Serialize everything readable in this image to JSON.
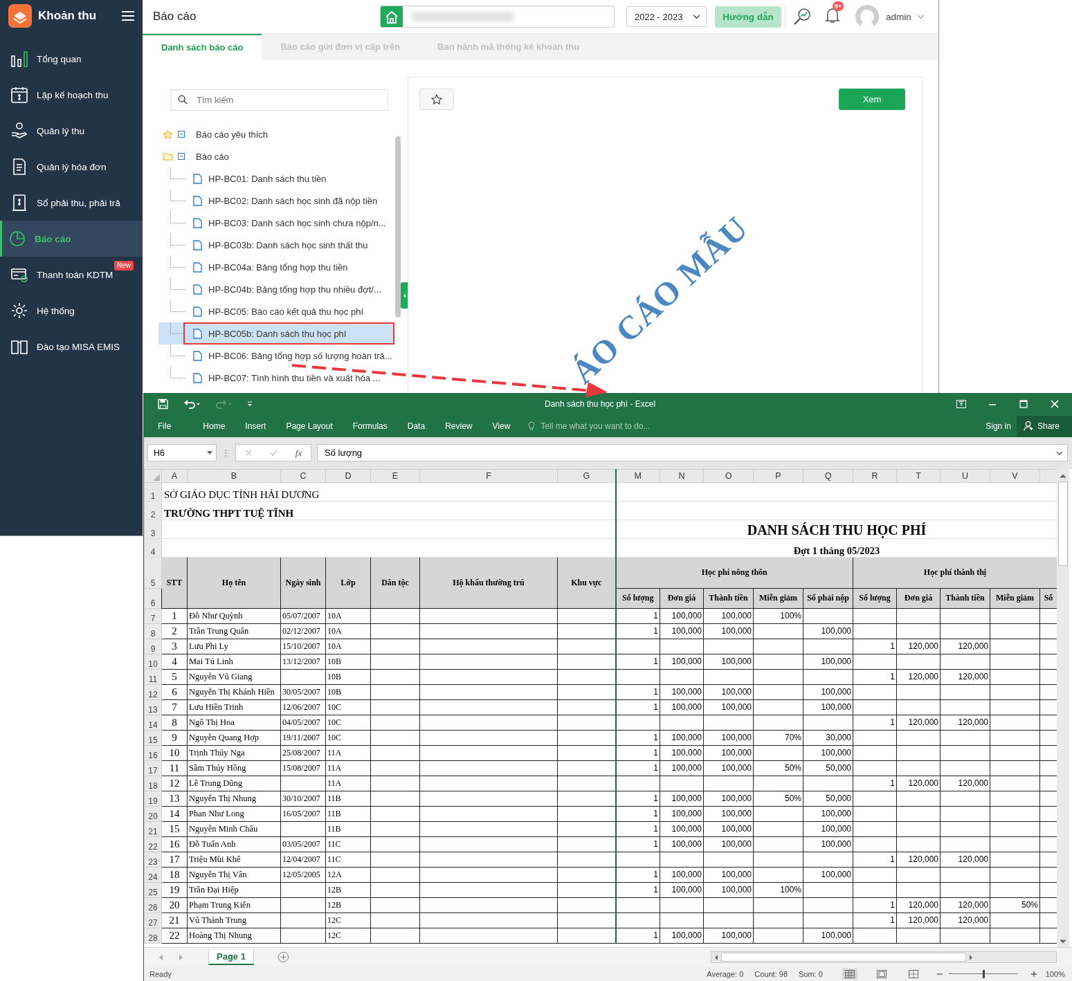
{
  "app": {
    "brand": "Khoản thu",
    "nav": [
      {
        "label": "Tổng quan",
        "selected": false
      },
      {
        "label": "Lập kế hoạch thu",
        "selected": false
      },
      {
        "label": "Quản lý thu",
        "selected": false
      },
      {
        "label": "Quản lý hóa đơn",
        "selected": false
      },
      {
        "label": "Sổ phải thu, phải trả",
        "selected": false
      },
      {
        "label": "Báo cáo",
        "selected": true
      },
      {
        "label": "Thanh toán KDTM",
        "selected": false,
        "badge": "New"
      },
      {
        "label": "Hệ thống",
        "selected": false
      },
      {
        "label": "Đào tạo MISA EMIS",
        "selected": false
      }
    ],
    "header": {
      "title": "Báo cáo",
      "year": "2022 - 2023",
      "guide_button": "Hướng dẫn",
      "notification_badge": "9+",
      "user": "admin"
    },
    "tabs": [
      {
        "label": "Danh sách báo cáo",
        "selected": true
      },
      {
        "label": "Báo cáo gửi đơn vị cấp trên",
        "selected": false
      },
      {
        "label": "Ban hành mã thống kê khoản thu",
        "selected": false
      }
    ],
    "search": {
      "placeholder": "Tìm kiếm"
    },
    "tree": [
      {
        "label": "Báo cáo yêu thích",
        "kind": "favorites",
        "expanded": true
      },
      {
        "label": "Báo cáo",
        "kind": "folder",
        "expanded": true,
        "children": [
          {
            "label": "HP-BC01: Danh sách thu tiền",
            "selected": false,
            "highlighted": false
          },
          {
            "label": "HP-BC02: Danh sách học sinh đã nộp tiền",
            "selected": false,
            "highlighted": false
          },
          {
            "label": "HP-BC03: Danh sách học sinh chưa nộp/n...",
            "selected": false,
            "highlighted": false
          },
          {
            "label": "HP-BC03b: Danh sách học sinh thất thu",
            "selected": false,
            "highlighted": false
          },
          {
            "label": "HP-BC04a: Bảng tổng hợp thu tiền",
            "selected": false,
            "highlighted": false
          },
          {
            "label": "HP-BC04b: Bảng tổng hợp thu nhiều đợt/...",
            "selected": false,
            "highlighted": false
          },
          {
            "label": "HP-BC05: Báo cáo kết quả thu học phí",
            "selected": false,
            "highlighted": false
          },
          {
            "label": "HP-BC05b: Danh sách thu học phí",
            "selected": true,
            "highlighted": true
          },
          {
            "label": "HP-BC06: Bảng tổng hợp số lượng hoàn trả...",
            "selected": false,
            "highlighted": false
          },
          {
            "label": "HP-BC07: Tình hình thu tiền và xuất hóa ...",
            "selected": false,
            "highlighted": false
          }
        ]
      }
    ],
    "preview": {
      "view_button": "Xem",
      "watermark": "ÁO CÁO MẪU"
    }
  },
  "excel": {
    "title": "Danh sách thu học phí - Excel",
    "menu": [
      "File",
      "Home",
      "Insert",
      "Page Layout",
      "Formulas",
      "Data",
      "Review",
      "View"
    ],
    "tell_me": {
      "placeholder": "Tell me what you want to do..."
    },
    "sign_in": "Sign in",
    "share": "Share",
    "name_box": "H6",
    "function_symbol": "fx",
    "formula": "Số lượng",
    "columns": [
      "A",
      "B",
      "C",
      "D",
      "E",
      "F",
      "G",
      "M",
      "N",
      "O",
      "P",
      "Q",
      "R",
      "T",
      "U",
      "V"
    ],
    "title_rows": [
      {
        "row": "1",
        "kind": "org",
        "text": "SỞ GIÁO DỤC TỈNH HẢI DƯƠNG"
      },
      {
        "row": "2",
        "kind": "school",
        "text": "TRƯỜNG THPT TUỆ TĨNH"
      },
      {
        "row": "3",
        "kind": "title",
        "text": "DANH SÁCH THU HỌC PHÍ"
      },
      {
        "row": "4",
        "kind": "subtitle",
        "text": "Đợt 1 tháng 05/2023"
      }
    ],
    "header_rows": [
      "5",
      "6"
    ],
    "headers": [
      "STT",
      "Họ tên",
      "Ngày sinh",
      "Lớp",
      "Dân tộc",
      "Hộ khẩu thường trú",
      "Khu vực"
    ],
    "group_headers": [
      "Học phí nông thôn",
      "Học phí thành thị"
    ],
    "sub_headers": [
      "Số lượng",
      "Đơn giá",
      "Thành tiền",
      "Miễn giảm",
      "Số phải nộp",
      "Số lượng",
      "Đơn giá",
      "Thành tiền",
      "Miễn giảm",
      "Số"
    ],
    "rows": [
      {
        "row": "7",
        "stt": "1",
        "name": "Đỗ Như Quỳnh",
        "dob": "05/07/2007",
        "class": "10A",
        "rural": {
          "qty": "1",
          "price": "100,000",
          "amount": "100,000",
          "discount": "100%"
        }
      },
      {
        "row": "8",
        "stt": "2",
        "name": "Trần Trung Quân",
        "dob": "02/12/2007",
        "class": "10A",
        "rural": {
          "qty": "1",
          "price": "100,000",
          "amount": "100,000",
          "payable": "100,000"
        }
      },
      {
        "row": "9",
        "stt": "3",
        "name": "Lưu Phi Ly",
        "dob": "15/10/2007",
        "class": "10A",
        "urban": {
          "qty": "1",
          "price": "120,000",
          "amount": "120,000"
        }
      },
      {
        "row": "10",
        "stt": "4",
        "name": "Mai Tú Linh",
        "dob": "13/12/2007",
        "class": "10B",
        "rural": {
          "qty": "1",
          "price": "100,000",
          "amount": "100,000",
          "payable": "100,000"
        }
      },
      {
        "row": "11",
        "stt": "5",
        "name": "Nguyễn Vũ Giang",
        "class": "10B",
        "urban": {
          "qty": "1",
          "price": "120,000",
          "amount": "120,000"
        }
      },
      {
        "row": "12",
        "stt": "6",
        "name": "Nguyễn Thị Khánh Hiền",
        "dob": "30/05/2007",
        "class": "10B",
        "rural": {
          "qty": "1",
          "price": "100,000",
          "amount": "100,000",
          "payable": "100,000"
        }
      },
      {
        "row": "13",
        "stt": "7",
        "name": "Lưu Hiền Trinh",
        "dob": "12/06/2007",
        "class": "10C",
        "rural": {
          "qty": "1",
          "price": "100,000",
          "amount": "100,000",
          "payable": "100,000"
        }
      },
      {
        "row": "14",
        "stt": "8",
        "name": "Ngô Thị Hoa",
        "dob": "04/05/2007",
        "class": "10C",
        "urban": {
          "qty": "1",
          "price": "120,000",
          "amount": "120,000"
        }
      },
      {
        "row": "15",
        "stt": "9",
        "name": "Nguyễn Quang Hợp",
        "dob": "19/11/2007",
        "class": "10C",
        "rural": {
          "qty": "1",
          "price": "100,000",
          "amount": "100,000",
          "discount": "70%",
          "payable": "30,000"
        }
      },
      {
        "row": "16",
        "stt": "10",
        "name": "Trịnh Thúy Nga",
        "dob": "25/08/2007",
        "class": "11A",
        "rural": {
          "qty": "1",
          "price": "100,000",
          "amount": "100,000",
          "payable": "100,000"
        }
      },
      {
        "row": "17",
        "stt": "11",
        "name": "Sầm Thúy Hồng",
        "dob": "15/08/2007",
        "class": "11A",
        "rural": {
          "qty": "1",
          "price": "100,000",
          "amount": "100,000",
          "discount": "50%",
          "payable": "50,000"
        }
      },
      {
        "row": "18",
        "stt": "12",
        "name": "Lê Trung Dũng",
        "class": "11A",
        "urban": {
          "qty": "1",
          "price": "120,000",
          "amount": "120,000"
        }
      },
      {
        "row": "19",
        "stt": "13",
        "name": "Nguyễn Thị Nhung",
        "dob": "30/10/2007",
        "class": "11B",
        "rural": {
          "qty": "1",
          "price": "100,000",
          "amount": "100,000",
          "discount": "50%",
          "payable": "50,000"
        }
      },
      {
        "row": "20",
        "stt": "14",
        "name": "Phan Như Long",
        "dob": "16/05/2007",
        "class": "11B",
        "rural": {
          "qty": "1",
          "price": "100,000",
          "amount": "100,000",
          "payable": "100,000"
        }
      },
      {
        "row": "21",
        "stt": "15",
        "name": "Nguyễn Minh Châu",
        "class": "11B",
        "rural": {
          "qty": "1",
          "price": "100,000",
          "amount": "100,000",
          "payable": "100,000"
        }
      },
      {
        "row": "22",
        "stt": "16",
        "name": "Đỗ Tuấn Anh",
        "dob": "03/05/2007",
        "class": "11C",
        "rural": {
          "qty": "1",
          "price": "100,000",
          "amount": "100,000",
          "payable": "100,000"
        }
      },
      {
        "row": "23",
        "stt": "17",
        "name": "Triệu Mùi Khê",
        "dob": "12/04/2007",
        "class": "11C",
        "urban": {
          "qty": "1",
          "price": "120,000",
          "amount": "120,000"
        }
      },
      {
        "row": "24",
        "stt": "18",
        "name": "Nguyễn Thị Vân",
        "dob": "12/05/2005",
        "class": "12A",
        "rural": {
          "qty": "1",
          "price": "100,000",
          "amount": "100,000",
          "payable": "100,000"
        }
      },
      {
        "row": "25",
        "stt": "19",
        "name": "Trần Đại Hiệp",
        "class": "12B",
        "rural": {
          "qty": "1",
          "price": "100,000",
          "amount": "100,000",
          "discount": "100%"
        }
      },
      {
        "row": "26",
        "stt": "20",
        "name": "Phạm Trung Kiên",
        "class": "12B",
        "urban": {
          "qty": "1",
          "price": "120,000",
          "amount": "120,000",
          "discount": "50%"
        }
      },
      {
        "row": "27",
        "stt": "21",
        "name": "Vũ Thành Trung",
        "class": "12C",
        "urban": {
          "qty": "1",
          "price": "120,000",
          "amount": "120,000"
        }
      },
      {
        "row": "28",
        "stt": "22",
        "name": "Hoàng Thị Nhung",
        "class": "12C",
        "rural": {
          "qty": "1",
          "price": "100,000",
          "amount": "100,000",
          "payable": "100,000"
        }
      }
    ],
    "sheet_tabs": [
      {
        "label": "Page 1",
        "selected": true
      }
    ],
    "status": "Ready",
    "stats": [
      "Average: 0",
      "Count: 98",
      "Sum: 0"
    ],
    "zoom": {
      "level": 0.5,
      "label": "100%"
    }
  }
}
